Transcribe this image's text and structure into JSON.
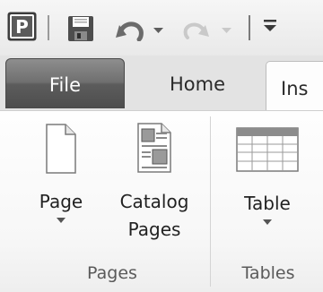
{
  "quick_access": {
    "app_icon": "publisher-icon",
    "save_icon": "save-icon",
    "undo_icon": "undo-icon",
    "redo_icon": "redo-icon",
    "customize_icon": "customize-toolbar-icon"
  },
  "tabs": {
    "file": "File",
    "home": "Home",
    "insert": "Ins"
  },
  "ribbon": {
    "groups": [
      {
        "label": "Pages",
        "buttons": [
          {
            "label": "Page",
            "icon": "blank-page-icon",
            "has_dropdown": true
          },
          {
            "label_line1": "Catalog",
            "label_line2": "Pages",
            "icon": "catalog-pages-icon",
            "has_dropdown": false
          }
        ]
      },
      {
        "label": "Tables",
        "buttons": [
          {
            "label": "Table",
            "icon": "table-icon",
            "has_dropdown": true
          }
        ]
      }
    ]
  },
  "colors": {
    "file_tab": "#6a6a6a",
    "ribbon_bg": "#f9f9f9",
    "tab_strip": "#e3e3e3"
  }
}
